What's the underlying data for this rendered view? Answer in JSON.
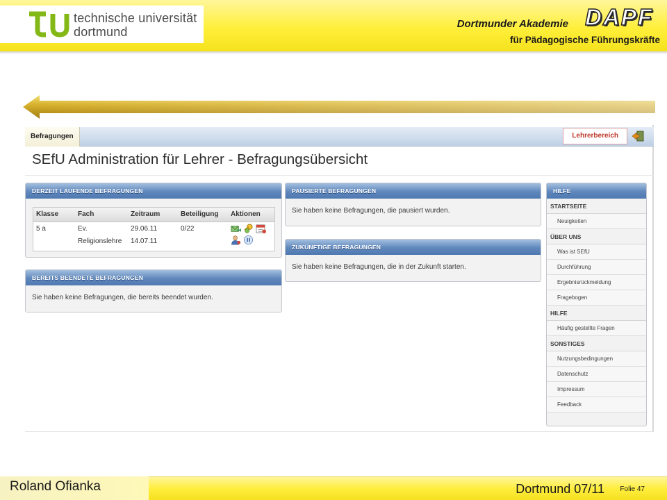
{
  "header": {
    "university_line1": "technische universität",
    "university_line2": "dortmund",
    "academy_line1": "Dortmunder Akademie",
    "academy_line2": "für Pädagogische Führungskräfte",
    "academy_logo": "DAPF"
  },
  "app": {
    "tab_active": "Befragungen",
    "tab_right": "Lehrerbereich",
    "page_title": "SEfU Administration für Lehrer - Befragungsübersicht",
    "running": {
      "title": "DERZEIT LAUFENDE BEFRAGUNGEN",
      "columns": [
        "Klasse",
        "Fach",
        "Zeitraum",
        "Beteiligung",
        "Aktionen"
      ],
      "rows": [
        {
          "klasse": "5 a",
          "fach_line1": "Ev.",
          "fach_line2": "Religionslehre",
          "zeitraum_line1": "29.06.11",
          "zeitraum_line2": "14.07.11",
          "beteiligung": "0/22",
          "actions": [
            "mail-icon",
            "key-icon",
            "calendar-icon",
            "user-icon",
            "pause-icon"
          ]
        }
      ]
    },
    "finished": {
      "title": "BEREITS BEENDETE BEFRAGUNGEN",
      "message": "Sie haben keine Befragungen, die bereits beendet wurden."
    },
    "paused": {
      "title": "PAUSIERTE BEFRAGUNGEN",
      "message": "Sie haben keine Befragungen, die pausiert wurden."
    },
    "future": {
      "title": "ZUKÜNFTIGE BEFRAGUNGEN",
      "message": "Sie haben keine Befragungen, die in der Zukunft starten."
    },
    "help": {
      "title": "HILFE",
      "sections": [
        {
          "label": "STARTSEITE",
          "items": [
            "Neuigkeiten"
          ]
        },
        {
          "label": "ÜBER UNS",
          "items": [
            "Was ist SEfU",
            "Durchführung",
            "Ergebnisrückmeldung",
            "Fragebogen"
          ]
        },
        {
          "label": "HILFE",
          "items": [
            "Häufig gestellte Fragen"
          ]
        },
        {
          "label": "SONSTIGES",
          "items": [
            "Nutzungsbedingungen",
            "Datenschutz",
            "Impressum",
            "Feedback"
          ]
        }
      ]
    }
  },
  "footer": {
    "author": "Roland Ofianka",
    "place_date": "Dortmund 07/11",
    "slide_label": "Folie 47"
  },
  "colors": {
    "header_yellow": "#ffef3a",
    "tu_green": "#84b817",
    "panel_blue": "#5f87bc",
    "arrow_gold": "#c9a321",
    "lehrerbereich_red": "#c0392b"
  }
}
